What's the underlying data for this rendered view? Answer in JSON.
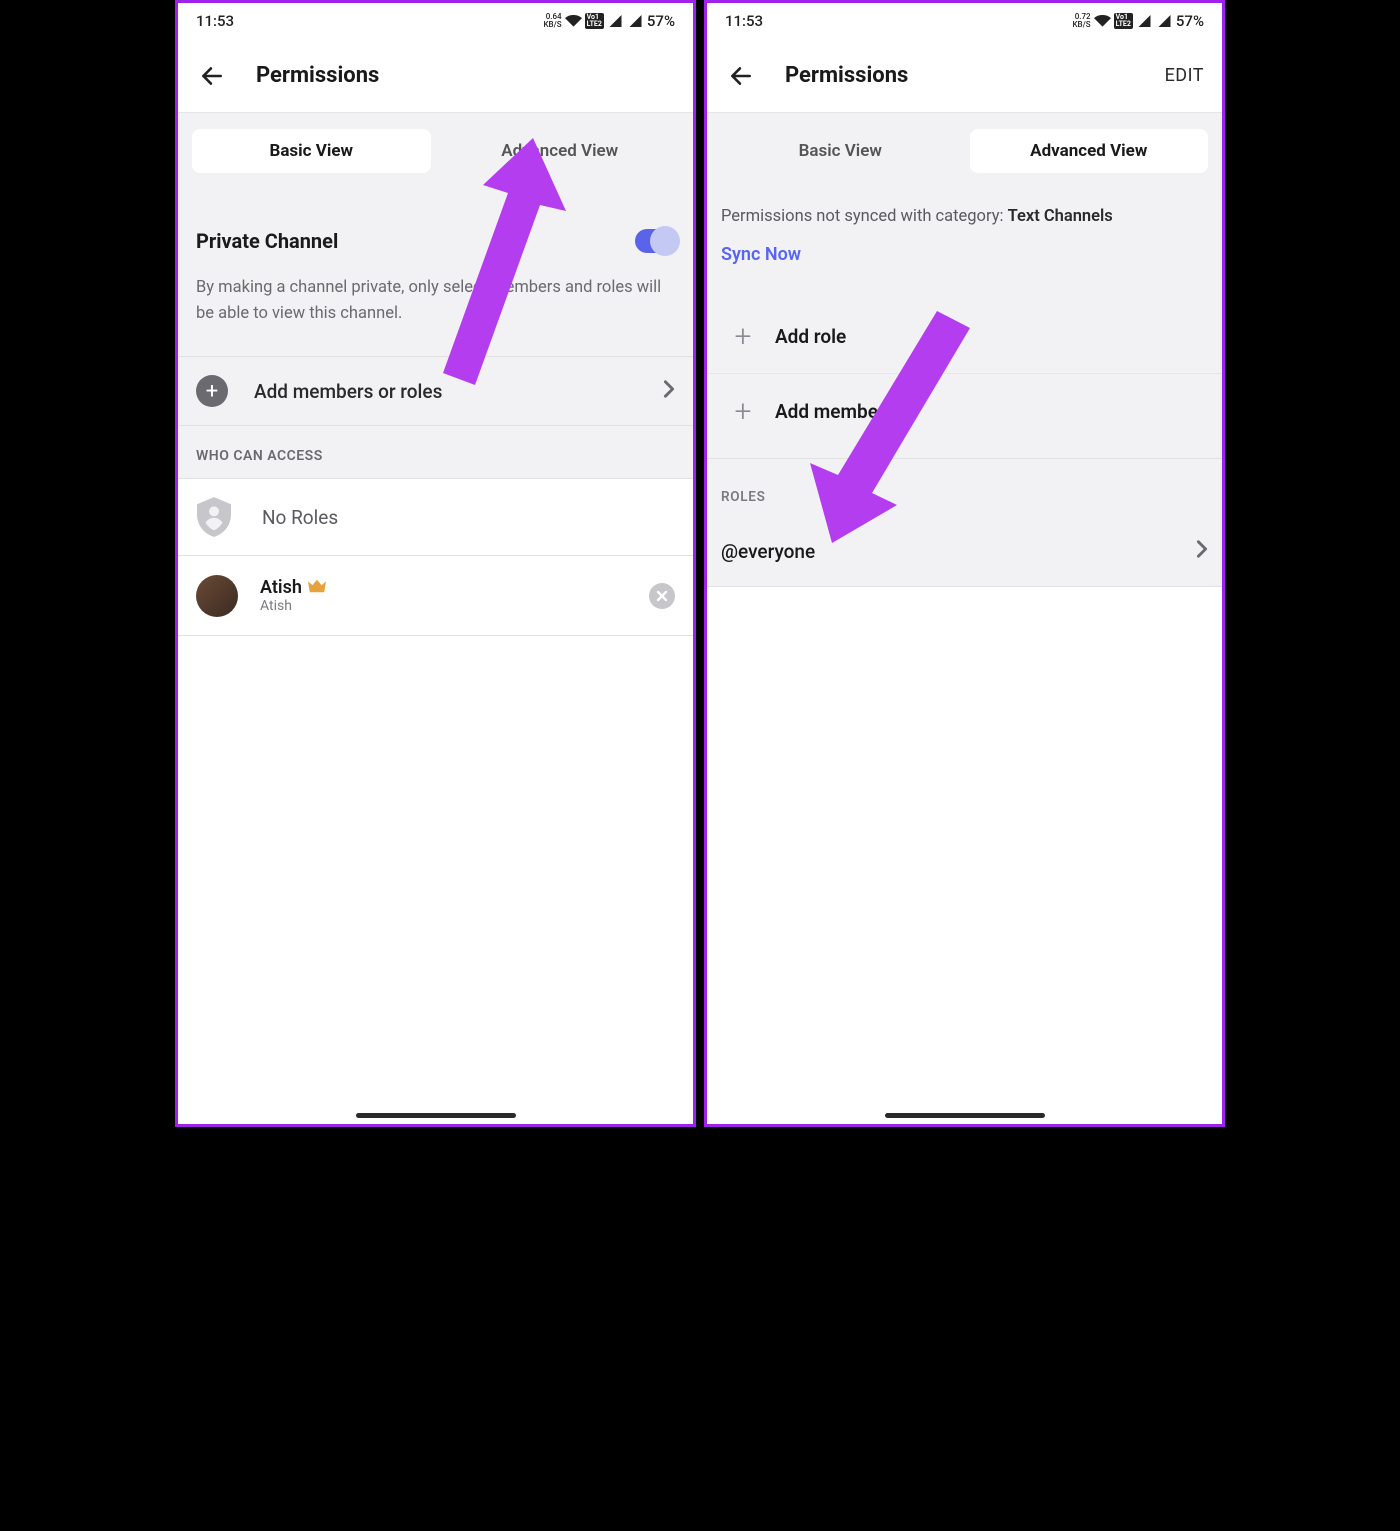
{
  "statusbar": {
    "time": "11:53",
    "kbps_left": "0.64",
    "kbps_right": "0.72",
    "kbps_unit": "KB/S",
    "lte1": "Vo1",
    "lte2": "LTE2",
    "battery": "57%"
  },
  "left": {
    "title": "Permissions",
    "tabs": {
      "basic": "Basic View",
      "advanced": "Advanced View"
    },
    "private_title": "Private Channel",
    "private_desc": "By making a channel private, only select members and roles will be able to view this channel.",
    "add_members": "Add members or roles",
    "who_header": "WHO CAN ACCESS",
    "no_roles": "No Roles",
    "member": {
      "name": "Atish",
      "sub": "Atish"
    }
  },
  "right": {
    "title": "Permissions",
    "edit": "EDIT",
    "tabs": {
      "basic": "Basic View",
      "advanced": "Advanced View"
    },
    "sync_text_pre": "Permissions not synced with category: ",
    "sync_category": "Text Channels",
    "sync_now": "Sync Now",
    "add_role": "Add role",
    "add_member": "Add member",
    "roles_header": "ROLES",
    "everyone": "@everyone"
  }
}
